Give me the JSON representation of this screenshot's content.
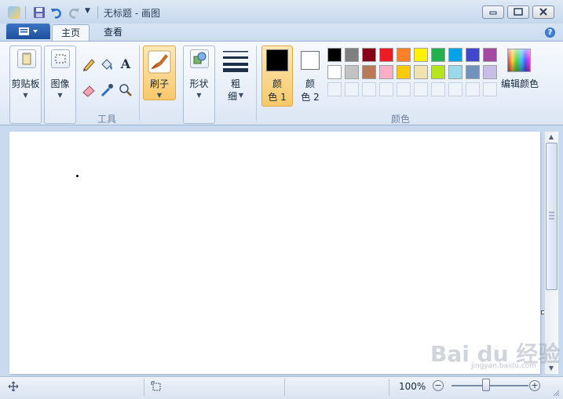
{
  "window": {
    "title": "无标题 - 画图"
  },
  "tabs": [
    {
      "label": "主页"
    },
    {
      "label": "查看"
    }
  ],
  "ribbon": {
    "clipboard_label": "剪贴板",
    "image_label": "图像",
    "tools_group_label": "工具",
    "brush_label": "刷子",
    "shapes_label": "形状",
    "size_label_1": "粗",
    "size_label_2": "细",
    "color1_label_1": "颜",
    "color1_label_2": "色 1",
    "color2_label_1": "颜",
    "color2_label_2": "色 2",
    "colors_group_label": "颜色",
    "edit_colors_label": "编辑颜色",
    "text_tool_glyph": "A",
    "color1_value": "#000000",
    "color2_value": "#ffffff",
    "palette_row1": [
      "#000000",
      "#7f7f7f",
      "#880015",
      "#ed1c24",
      "#ff7f27",
      "#fff200",
      "#22b14c",
      "#00a2e8",
      "#3f48cc",
      "#a349a4"
    ],
    "palette_row2": [
      "#ffffff",
      "#c3c3c3",
      "#b97a57",
      "#ffaec9",
      "#ffc90e",
      "#efe4b0",
      "#b5e61d",
      "#99d9ea",
      "#7092be",
      "#c8bfe7"
    ]
  },
  "status": {
    "zoom": "100%",
    "zoom_minus": "−",
    "zoom_plus": "+"
  },
  "watermark": {
    "text": "Bai du 经验",
    "sub": "jingyan.baidu.com"
  }
}
